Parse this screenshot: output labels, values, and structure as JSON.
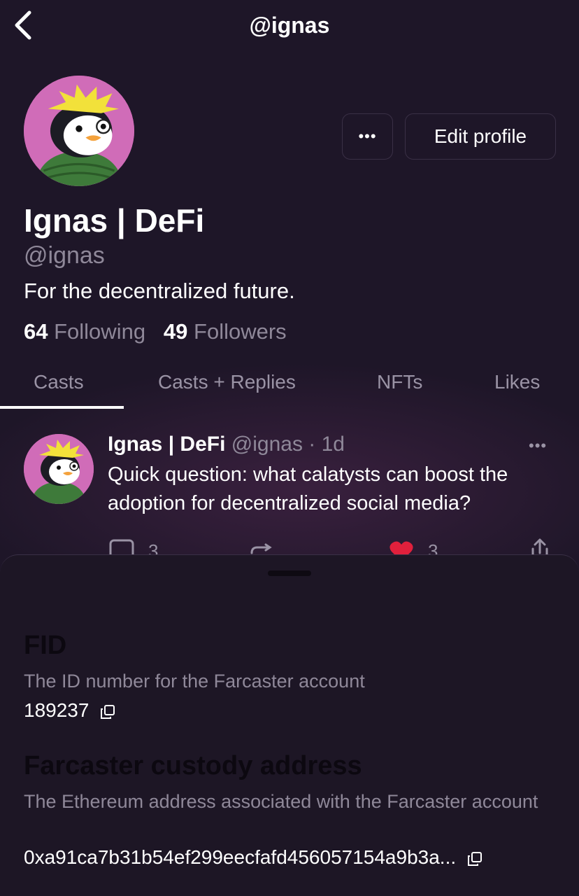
{
  "header": {
    "title": "@ignas"
  },
  "profile": {
    "display_name": "Ignas | DeFi",
    "handle": "@ignas",
    "bio": "For the decentralized future.",
    "following_count": "64",
    "following_label": "Following",
    "followers_count": "49",
    "followers_label": "Followers",
    "more_label": "•••",
    "edit_label": "Edit profile"
  },
  "tabs": [
    {
      "label": "Casts",
      "active": true
    },
    {
      "label": "Casts + Replies",
      "active": false
    },
    {
      "label": "NFTs",
      "active": false
    },
    {
      "label": "Likes",
      "active": false
    }
  ],
  "cast": {
    "author_name": "Ignas | DeFi",
    "meta": " @ignas · 1d",
    "more_label": "•••",
    "text": "Quick question: what calatysts can boost the adoption for decentralized social media?",
    "reply_count": "3",
    "like_count": "3"
  },
  "sheet": {
    "fid_title": "FID",
    "fid_desc": "The ID number for the Farcaster account",
    "fid_value": "189237",
    "custody_title": "Farcaster custody address",
    "custody_desc": "The Ethereum address associated with the Farcaster account",
    "custody_value": "0xa91ca7b31b54ef299eecfafd456057154a9b3a..."
  },
  "colors": {
    "background": "#1e1628",
    "muted_text": "#8f8899",
    "like_red": "#e0203c",
    "avatar_pink": "#d06cb8"
  },
  "icons": [
    "back-icon",
    "more-dots-icon",
    "reply-icon",
    "recast-icon",
    "heart-icon",
    "share-icon",
    "copy-icon"
  ]
}
